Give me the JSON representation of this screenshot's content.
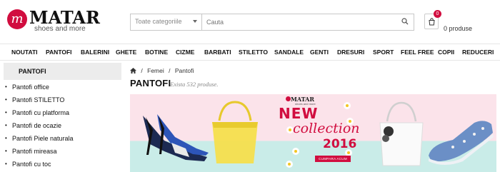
{
  "header": {
    "brand": "MATAR",
    "logo_letter": "m",
    "tagline": "shoes and more",
    "category_placeholder": "Toate categoriile",
    "search_placeholder": "Cauta",
    "cart_count": "0",
    "cart_label": "0 produse"
  },
  "nav": {
    "items": [
      "NOUTATI",
      "PANTOFI",
      "BALERINI",
      "GHETE",
      "BOTINE",
      "CIZME",
      "BARBATI",
      "STILETTO",
      "SANDALE",
      "GENTI",
      "DRESURI",
      "SPORT",
      "FEEL FREE",
      "COPII",
      "REDUCERI"
    ]
  },
  "sidebar": {
    "heading": "PANTOFI",
    "items": [
      "Pantofi office",
      "Pantofi STILETTO",
      "Pantofi cu platforma",
      "Pantofi de ocazie",
      "Pantofi Piele naturala",
      "Pantofi mireasa",
      "Pantofi cu toc"
    ]
  },
  "breadcrumb": {
    "items": [
      "Femei",
      "Pantofi"
    ],
    "separator": "/"
  },
  "page": {
    "title": "PANTOFI",
    "subtitle": "Exista 532 produse."
  },
  "banner": {
    "brand": "MATAR",
    "brand_sub": "shoes and more",
    "new": "NEW",
    "collection": "collection",
    "year": "2016",
    "cta": "CUMPARA ACUM"
  },
  "colors": {
    "accent": "#d10d3f",
    "banner_pink": "#fbe3ea",
    "banner_teal": "#c9ece8"
  },
  "icons": [
    "search-icon",
    "cart-icon",
    "home-icon",
    "chevron-down-icon"
  ]
}
